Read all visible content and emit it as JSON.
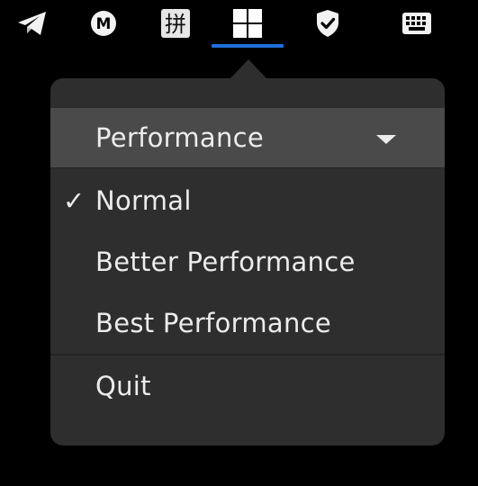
{
  "tray": {
    "items": [
      {
        "icon": "telegram-icon"
      },
      {
        "icon": "mega-icon",
        "glyph": "M"
      },
      {
        "icon": "pinyin-input-icon",
        "glyph": "拼"
      },
      {
        "icon": "windows-icon",
        "active": true
      },
      {
        "icon": "shield-check-icon"
      },
      {
        "icon": "keyboard-icon"
      }
    ],
    "accent_color": "#1e6fd9"
  },
  "menu": {
    "header": {
      "label": "Performance"
    },
    "items": [
      {
        "label": "Normal",
        "check": "✓",
        "checked": true
      },
      {
        "label": "Better Performance",
        "check": "",
        "checked": false
      },
      {
        "label": "Best Performance",
        "check": "",
        "checked": false
      }
    ],
    "quit": {
      "label": "Quit"
    }
  }
}
